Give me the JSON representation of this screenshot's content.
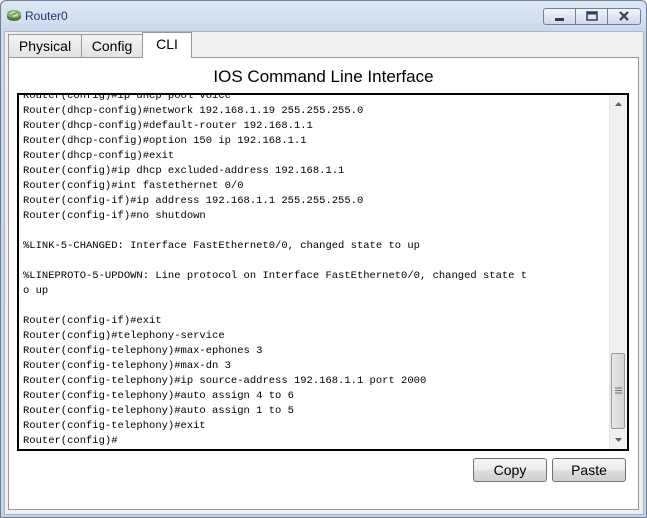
{
  "window": {
    "title": "Router0",
    "icon": "router-icon",
    "controls": [
      "minimize-icon",
      "maximize-icon",
      "close-icon"
    ]
  },
  "tabs": [
    {
      "label": "Physical",
      "active": false
    },
    {
      "label": "Config",
      "active": false
    },
    {
      "label": "CLI",
      "active": true
    }
  ],
  "panel": {
    "title": "IOS Command Line Interface"
  },
  "console": {
    "lines": [
      "Router(config)#ip dhcp pool voice",
      "Router(dhcp-config)#network 192.168.1.19 255.255.255.0",
      "Router(dhcp-config)#default-router 192.168.1.1",
      "Router(dhcp-config)#option 150 ip 192.168.1.1",
      "Router(dhcp-config)#exit",
      "Router(config)#ip dhcp excluded-address 192.168.1.1",
      "Router(config)#int fastethernet 0/0",
      "Router(config-if)#ip address 192.168.1.1 255.255.255.0",
      "Router(config-if)#no shutdown",
      "",
      "%LINK-5-CHANGED: Interface FastEthernet0/0, changed state to up",
      "",
      "%LINEPROTO-5-UPDOWN: Line protocol on Interface FastEthernet0/0, changed state t",
      "o up",
      "",
      "Router(config-if)#exit",
      "Router(config)#telephony-service",
      "Router(config-telephony)#max-ephones 3",
      "Router(config-telephony)#max-dn 3",
      "Router(config-telephony)#ip source-address 192.168.1.1 port 2000",
      "Router(config-telephony)#auto assign 4 to 6",
      "Router(config-telephony)#auto assign 1 to 5",
      "Router(config-telephony)#exit",
      "Router(config)#"
    ]
  },
  "buttons": {
    "copy": "Copy",
    "paste": "Paste"
  }
}
